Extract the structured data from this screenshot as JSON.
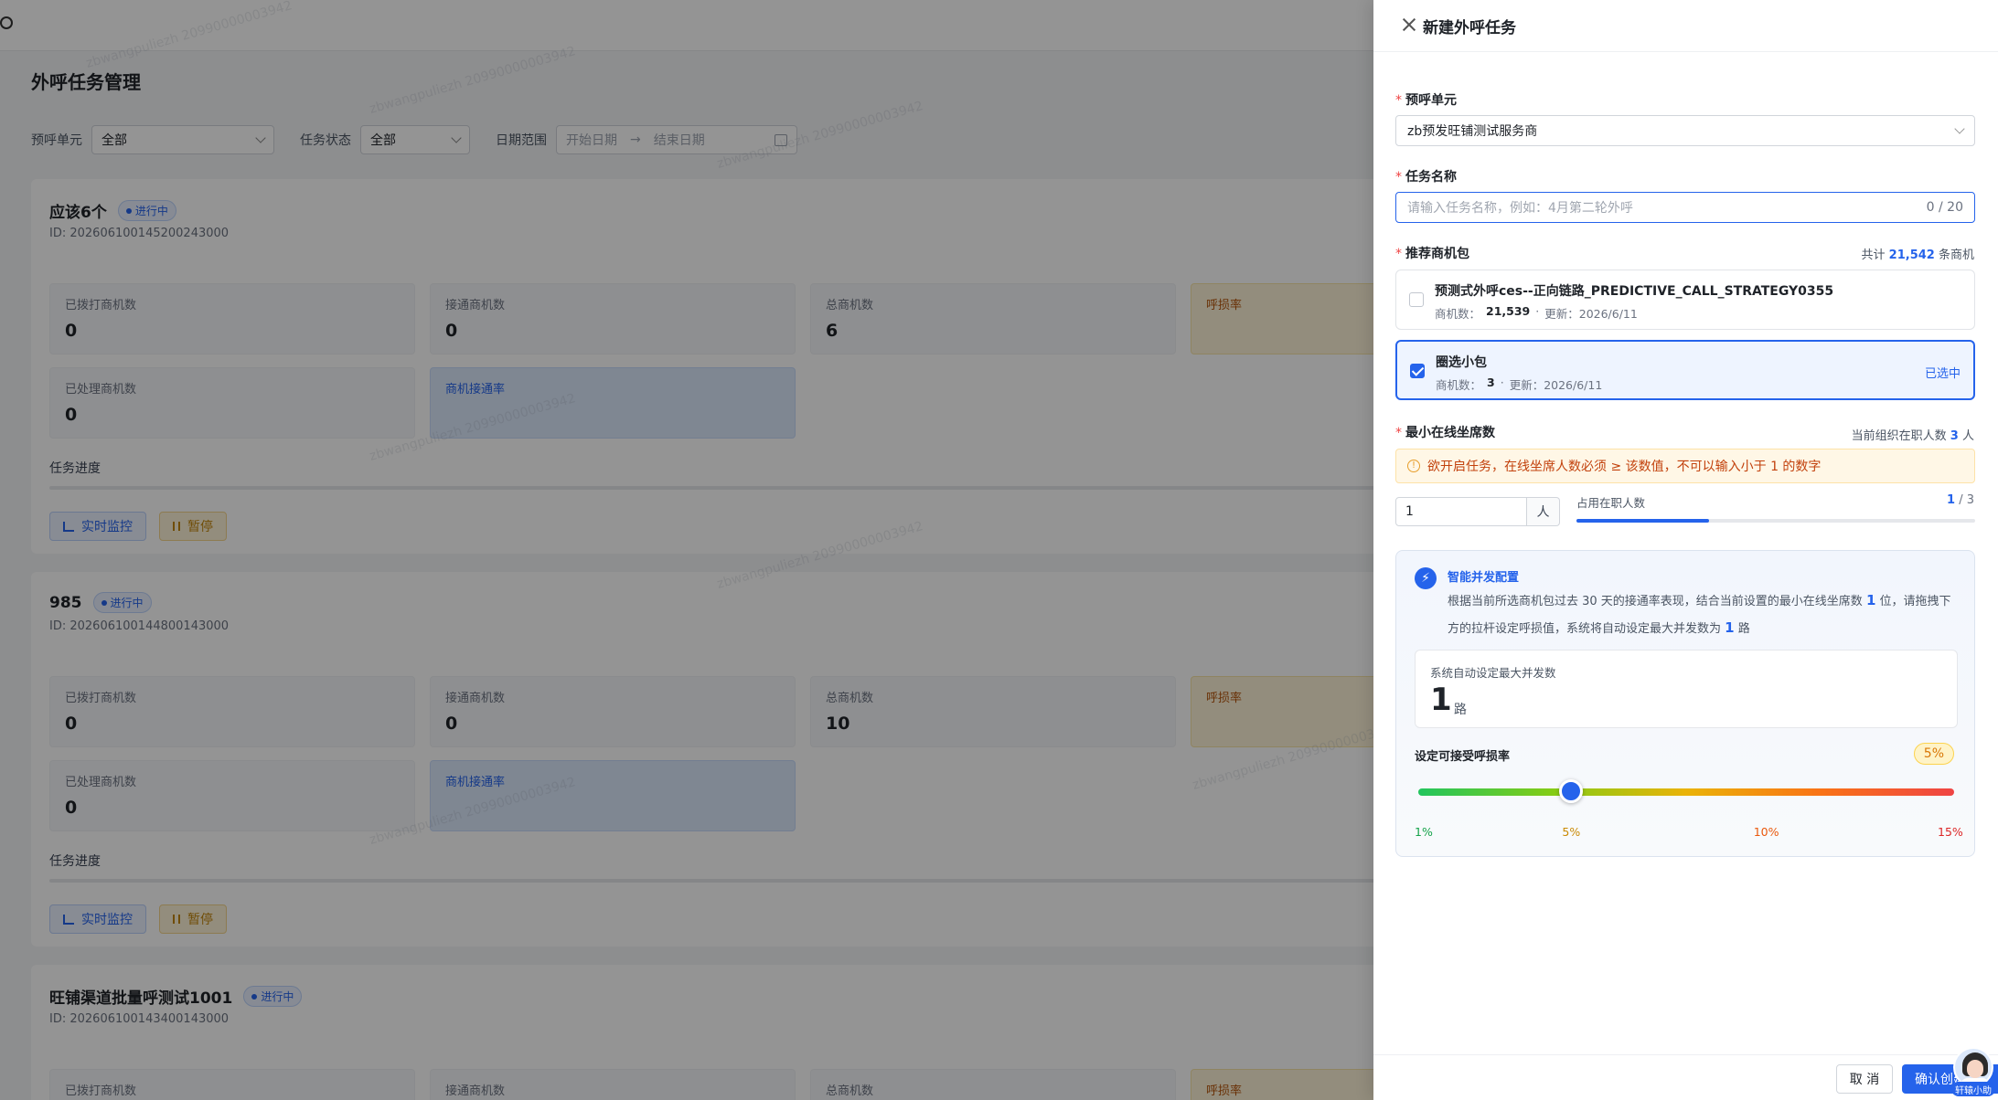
{
  "background": {
    "page_title": "外呼任务管理",
    "filters": {
      "unit_label": "预呼单元",
      "unit_value": "全部",
      "status_label": "任务状态",
      "status_value": "全部",
      "date_label": "日期范围",
      "start_placeholder": "开始日期",
      "arrow": "→",
      "end_placeholder": "结束日期"
    },
    "tasks": [
      {
        "name": "应该6个",
        "status": "进行中",
        "id": "ID: 20260610014520024300​0",
        "stats": {
          "dialed_label": "已拨打商机数",
          "dialed": "0",
          "connected_label": "接通商机数",
          "connected": "0",
          "total_label": "总商机数",
          "total": "6",
          "loss_label": "呼损率",
          "processed_label": "已处理商机数",
          "processed": "0",
          "rate_label": "商机接通率"
        },
        "progress_label": "任务进度",
        "monitor_label": "实时监控",
        "pause_label": "暂停"
      },
      {
        "name": "985",
        "status": "进行中",
        "id": "ID: 20260610014480014300​0",
        "stats": {
          "dialed_label": "已拨打商机数",
          "dialed": "0",
          "connected_label": "接通商机数",
          "connected": "0",
          "total_label": "总商机数",
          "total": "10",
          "loss_label": "呼损率",
          "processed_label": "已处理商机数",
          "processed": "0",
          "rate_label": "商机接通率"
        },
        "progress_label": "任务进度",
        "monitor_label": "实时监控",
        "pause_label": "暂停"
      },
      {
        "name": "旺铺渠道批量呼测试1001",
        "status": "进行中",
        "id": "ID: 20260610014340014300​0",
        "stats": {
          "dialed_label": "已拨打商机数",
          "connected_label": "接通商机数",
          "total_label": "总商机数",
          "loss_label": "呼损率"
        }
      }
    ]
  },
  "drawer": {
    "title": "新建外呼任务",
    "unit": {
      "label": "预呼单元",
      "value": "zb预发旺铺测试服务商"
    },
    "task_name": {
      "label": "任务名称",
      "placeholder": "请输入任务名称，例如：4月第二轮外呼",
      "count": "0 / 20"
    },
    "packages": {
      "label": "推荐商机包",
      "total_prefix": "共计",
      "total": "21,542",
      "total_suffix": "条商机",
      "items": [
        {
          "name": "预测式外呼ces--正向链路_PREDICTIVE_CALL_STRATEGY0355",
          "count_label": "商机数：",
          "count": "21,539",
          "sep": "·",
          "updated": "更新：2026/6/11",
          "selected": false
        },
        {
          "name": "圈选小包",
          "count_label": "商机数：",
          "count": "3",
          "sep": "·",
          "updated": "更新：2026/6/11",
          "selected": true,
          "selected_tag": "已选中"
        }
      ]
    },
    "min_seats": {
      "label": "最小在线坐席数",
      "staff_prefix": "当前组织在职人数",
      "staff": "3",
      "staff_suffix": "人",
      "warning_icon": "!",
      "warning": "欲开启任务，在线坐席人数必须 ≥ 该数值，不可以输入小于 1 的数字",
      "value": "1",
      "unit": "人",
      "occupancy_label": "占用在职人数",
      "occupancy": "1",
      "occupancy_total": "/ 3",
      "occupancy_fraction": 0.333
    },
    "smart": {
      "icon": "⚡",
      "title": "智能并发配置",
      "desc_1": "根据当前所选商机包过去 30 天的接通率表现，结合当前设置的最小在线坐席数",
      "desc_seats": "1",
      "desc_2": "位，请拖拽下方的拉杆设定呼损值，系统将自动设定最大并发数为",
      "desc_conc": "1",
      "desc_3": "路",
      "auto_label": "系统自动设定最大并发数",
      "auto_value": "1",
      "auto_unit": "路",
      "rate_label": "设定可接受呼损率",
      "rate_value": "5%",
      "rate_min": 1,
      "rate_max": 15,
      "rate_current": 5,
      "ticks": [
        {
          "label": "1%",
          "color": "#16a34a"
        },
        {
          "label": "5%",
          "color": "#ca8a04"
        },
        {
          "label": "10%",
          "color": "#ea580c"
        },
        {
          "label": "15%",
          "color": "#dc2626"
        }
      ]
    },
    "footer": {
      "cancel": "取 消",
      "confirm": "确认创建",
      "assistant": "轩辕小助"
    }
  },
  "watermark": "zbwangpuliezh 20990000003942"
}
